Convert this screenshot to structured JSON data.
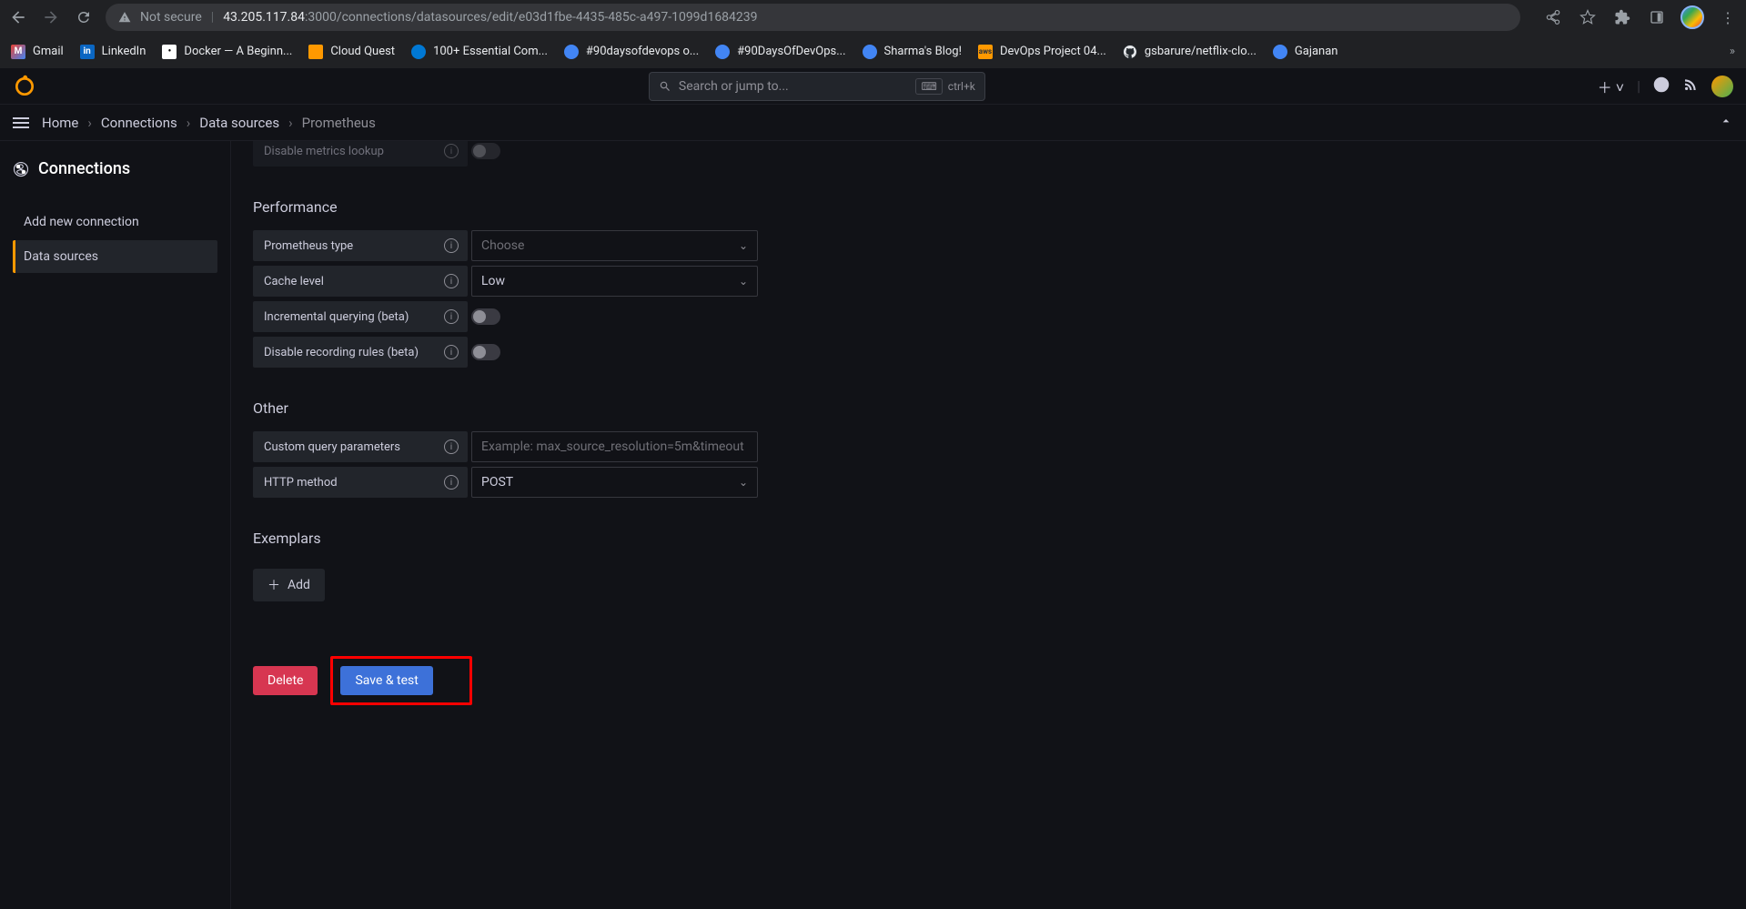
{
  "browser": {
    "url_prefix": "Not secure",
    "url_host": "43.205.117.84",
    "url_path": ":3000/connections/datasources/edit/e03d1fbe-4435-485c-a497-1099d1684239",
    "bookmarks": [
      {
        "label": "Gmail",
        "icon": "gmail"
      },
      {
        "label": "LinkedIn",
        "icon": "linkedin"
      },
      {
        "label": "Docker — A Beginn...",
        "icon": "docker"
      },
      {
        "label": "Cloud Quest",
        "icon": "aws"
      },
      {
        "label": "100+ Essential Com...",
        "icon": "cube"
      },
      {
        "label": "#90daysofdevops o...",
        "icon": "cube"
      },
      {
        "label": "#90DaysOfDevOps...",
        "icon": "cube"
      },
      {
        "label": "Sharma's Blog!",
        "icon": "cube"
      },
      {
        "label": "DevOps Project 04...",
        "icon": "aws2"
      },
      {
        "label": "gsbarure/netflix-clo...",
        "icon": "gh"
      },
      {
        "label": "Gajanan",
        "icon": "cube"
      }
    ]
  },
  "topbar": {
    "search_placeholder": "Search or jump to...",
    "shortcut": "ctrl+k"
  },
  "breadcrumb": {
    "items": [
      "Home",
      "Connections",
      "Data sources",
      "Prometheus"
    ]
  },
  "sidebar": {
    "title": "Connections",
    "items": [
      {
        "label": "Add new connection",
        "active": false
      },
      {
        "label": "Data sources",
        "active": true
      }
    ]
  },
  "form": {
    "disable_metrics_label": "Disable metrics lookup",
    "performance_header": "Performance",
    "prometheus_type_label": "Prometheus type",
    "prometheus_type_value": "Choose",
    "cache_level_label": "Cache level",
    "cache_level_value": "Low",
    "incremental_querying_label": "Incremental querying (beta)",
    "disable_recording_label": "Disable recording rules (beta)",
    "other_header": "Other",
    "custom_query_label": "Custom query parameters",
    "custom_query_placeholder": "Example: max_source_resolution=5m&timeout",
    "http_method_label": "HTTP method",
    "http_method_value": "POST",
    "exemplars_header": "Exemplars",
    "add_button": "Add",
    "delete_button": "Delete",
    "save_button": "Save & test"
  }
}
